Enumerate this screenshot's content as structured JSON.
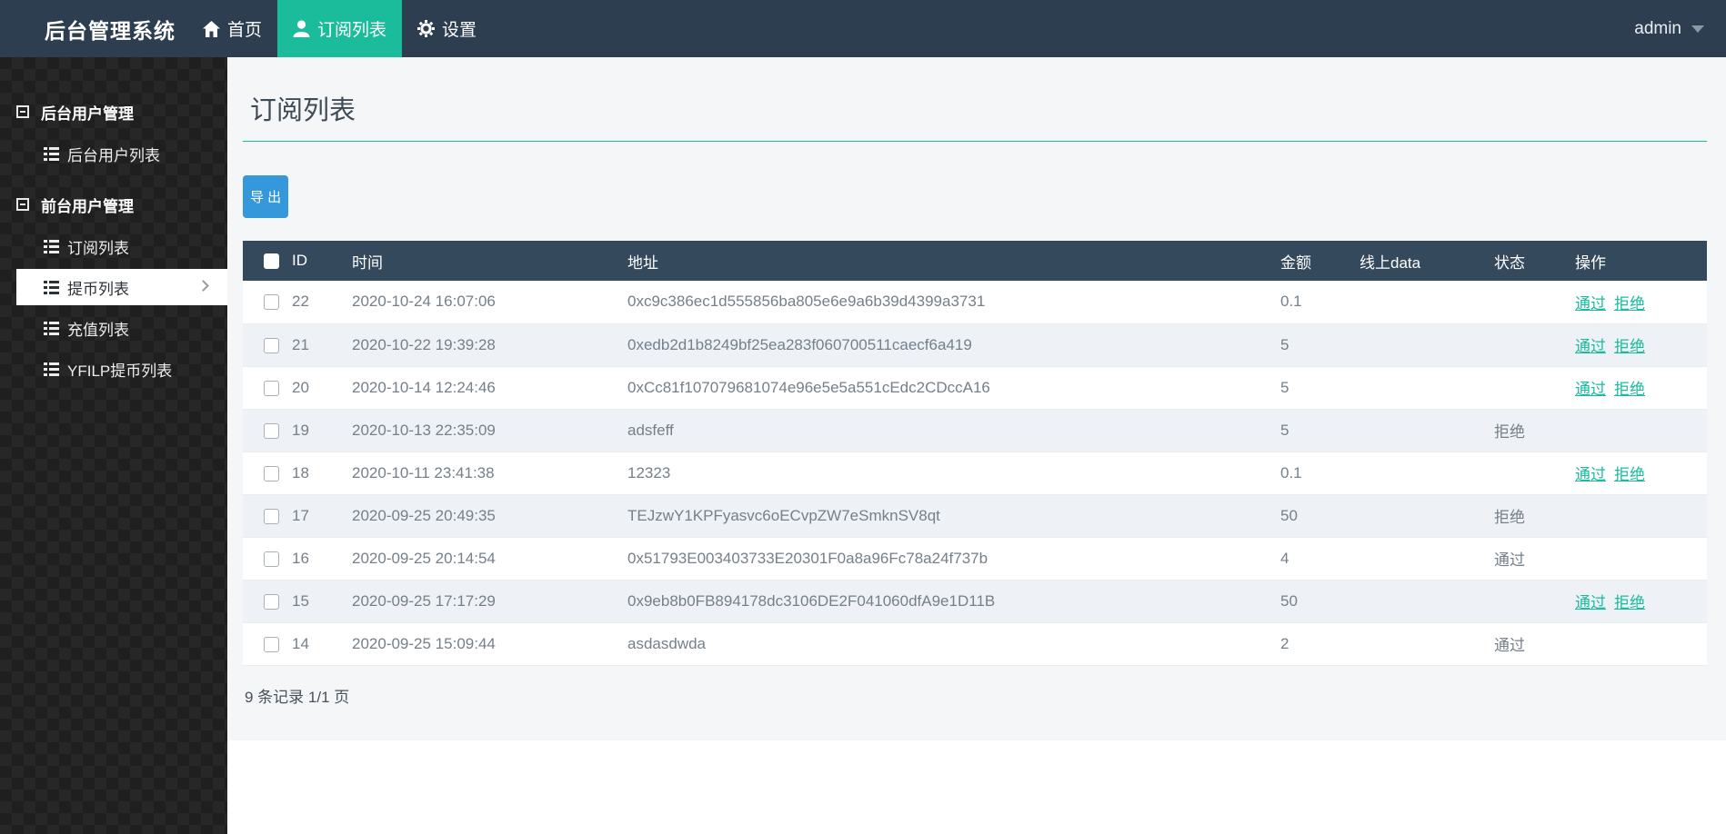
{
  "navbar": {
    "brand": "后台管理系统",
    "items": [
      {
        "label": "首页",
        "icon": "home-icon",
        "active": false
      },
      {
        "label": "订阅列表",
        "icon": "user-icon",
        "active": true
      },
      {
        "label": "设置",
        "icon": "gear-icon",
        "active": false
      }
    ],
    "user": {
      "name": "admin",
      "icon": "caret-down-icon"
    }
  },
  "sidebar": {
    "sections": [
      {
        "label": "后台用户管理",
        "icon": "collapse-minus-icon",
        "children": [
          {
            "label": "后台用户列表",
            "icon": "list-icon",
            "active": false
          }
        ]
      },
      {
        "label": "前台用户管理",
        "icon": "collapse-minus-icon",
        "children": [
          {
            "label": "订阅列表",
            "icon": "list-icon",
            "active": false
          },
          {
            "label": "提币列表",
            "icon": "list-icon",
            "active": true
          },
          {
            "label": "充值列表",
            "icon": "list-icon",
            "active": false
          },
          {
            "label": "YFILP提币列表",
            "icon": "list-icon",
            "active": false
          }
        ]
      }
    ]
  },
  "main": {
    "title": "订阅列表",
    "export_button": "导 出",
    "table": {
      "headers": [
        "ID",
        "时间",
        "地址",
        "金额",
        "线上data",
        "状态",
        "操作"
      ],
      "rows": [
        {
          "id": "22",
          "time": "2020-10-24 16:07:06",
          "address": "0xc9c386ec1d555856ba805e6e9a6b39d4399a3731",
          "amount": "0.1",
          "online_data": "",
          "status": "",
          "status_style": "",
          "actions": [
            {
              "label": "通过",
              "name": "approve"
            },
            {
              "label": "拒绝",
              "name": "reject"
            }
          ]
        },
        {
          "id": "21",
          "time": "2020-10-22 19:39:28",
          "address": "0xedb2d1b8249bf25ea283f060700511caecf6a419",
          "amount": "5",
          "online_data": "",
          "status": "",
          "status_style": "",
          "actions": [
            {
              "label": "通过",
              "name": "approve"
            },
            {
              "label": "拒绝",
              "name": "reject"
            }
          ]
        },
        {
          "id": "20",
          "time": "2020-10-14 12:24:46",
          "address": "0xCc81f107079681074e96e5e5a551cEdc2CDccA16",
          "amount": "5",
          "online_data": "",
          "status": "",
          "status_style": "",
          "actions": [
            {
              "label": "通过",
              "name": "approve"
            },
            {
              "label": "拒绝",
              "name": "reject"
            }
          ]
        },
        {
          "id": "19",
          "time": "2020-10-13 22:35:09",
          "address": "adsfeff",
          "amount": "5",
          "online_data": "",
          "status": "拒绝",
          "status_style": "rejected",
          "actions": []
        },
        {
          "id": "18",
          "time": "2020-10-11 23:41:38",
          "address": "12323",
          "amount": "0.1",
          "online_data": "",
          "status": "",
          "status_style": "",
          "actions": [
            {
              "label": "通过",
              "name": "approve"
            },
            {
              "label": "拒绝",
              "name": "reject"
            }
          ]
        },
        {
          "id": "17",
          "time": "2020-09-25 20:49:35",
          "address": "TEJzwY1KPFyasvc6oECvpZW7eSmknSV8qt",
          "amount": "50",
          "online_data": "",
          "status": "拒绝",
          "status_style": "rejected",
          "actions": []
        },
        {
          "id": "16",
          "time": "2020-09-25 20:14:54",
          "address": "0x51793E003403733E20301F0a8a96Fc78a24f737b",
          "amount": "4",
          "online_data": "",
          "status": "通过",
          "status_style": "passed",
          "actions": []
        },
        {
          "id": "15",
          "time": "2020-09-25 17:17:29",
          "address": "0x9eb8b0FB894178dc3106DE2F041060dfA9e1D11B",
          "amount": "50",
          "online_data": "",
          "status": "",
          "status_style": "",
          "actions": [
            {
              "label": "通过",
              "name": "approve"
            },
            {
              "label": "拒绝",
              "name": "reject"
            }
          ]
        },
        {
          "id": "14",
          "time": "2020-09-25 15:09:44",
          "address": "asdasdwda",
          "amount": "2",
          "online_data": "",
          "status": "通过",
          "status_style": "passed",
          "actions": []
        }
      ]
    },
    "footer": "9 条记录 1/1 页"
  },
  "colors": {
    "navbar_bg": "#2c3e50",
    "accent_green": "#1abc9c",
    "table_header_bg": "#35495c",
    "export_button_blue": "#3498db",
    "action_link_teal": "#18bc9c",
    "status_red": "#e74c3c",
    "row_stripe": "#eef1f5",
    "sidebar_bg": "#1f1f1f"
  }
}
